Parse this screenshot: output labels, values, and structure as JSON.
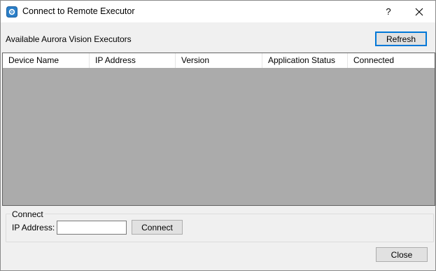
{
  "window": {
    "title": "Connect to Remote Executor",
    "help_label": "?"
  },
  "executors": {
    "label": "Available Aurora Vision Executors",
    "refresh_label": "Refresh",
    "columns": [
      "Device Name",
      "IP Address",
      "Version",
      "Application Status",
      "Connected"
    ],
    "rows": []
  },
  "connect_group": {
    "title": "Connect",
    "ip_label": "IP Address:",
    "ip_value": "",
    "connect_label": "Connect"
  },
  "footer": {
    "close_label": "Close"
  },
  "colors": {
    "window_bg": "#f0f0f0",
    "list_bg": "#ababab",
    "accent": "#0078d7"
  },
  "icons": {
    "app": "aurora-vision-app-icon",
    "close": "close-icon"
  }
}
